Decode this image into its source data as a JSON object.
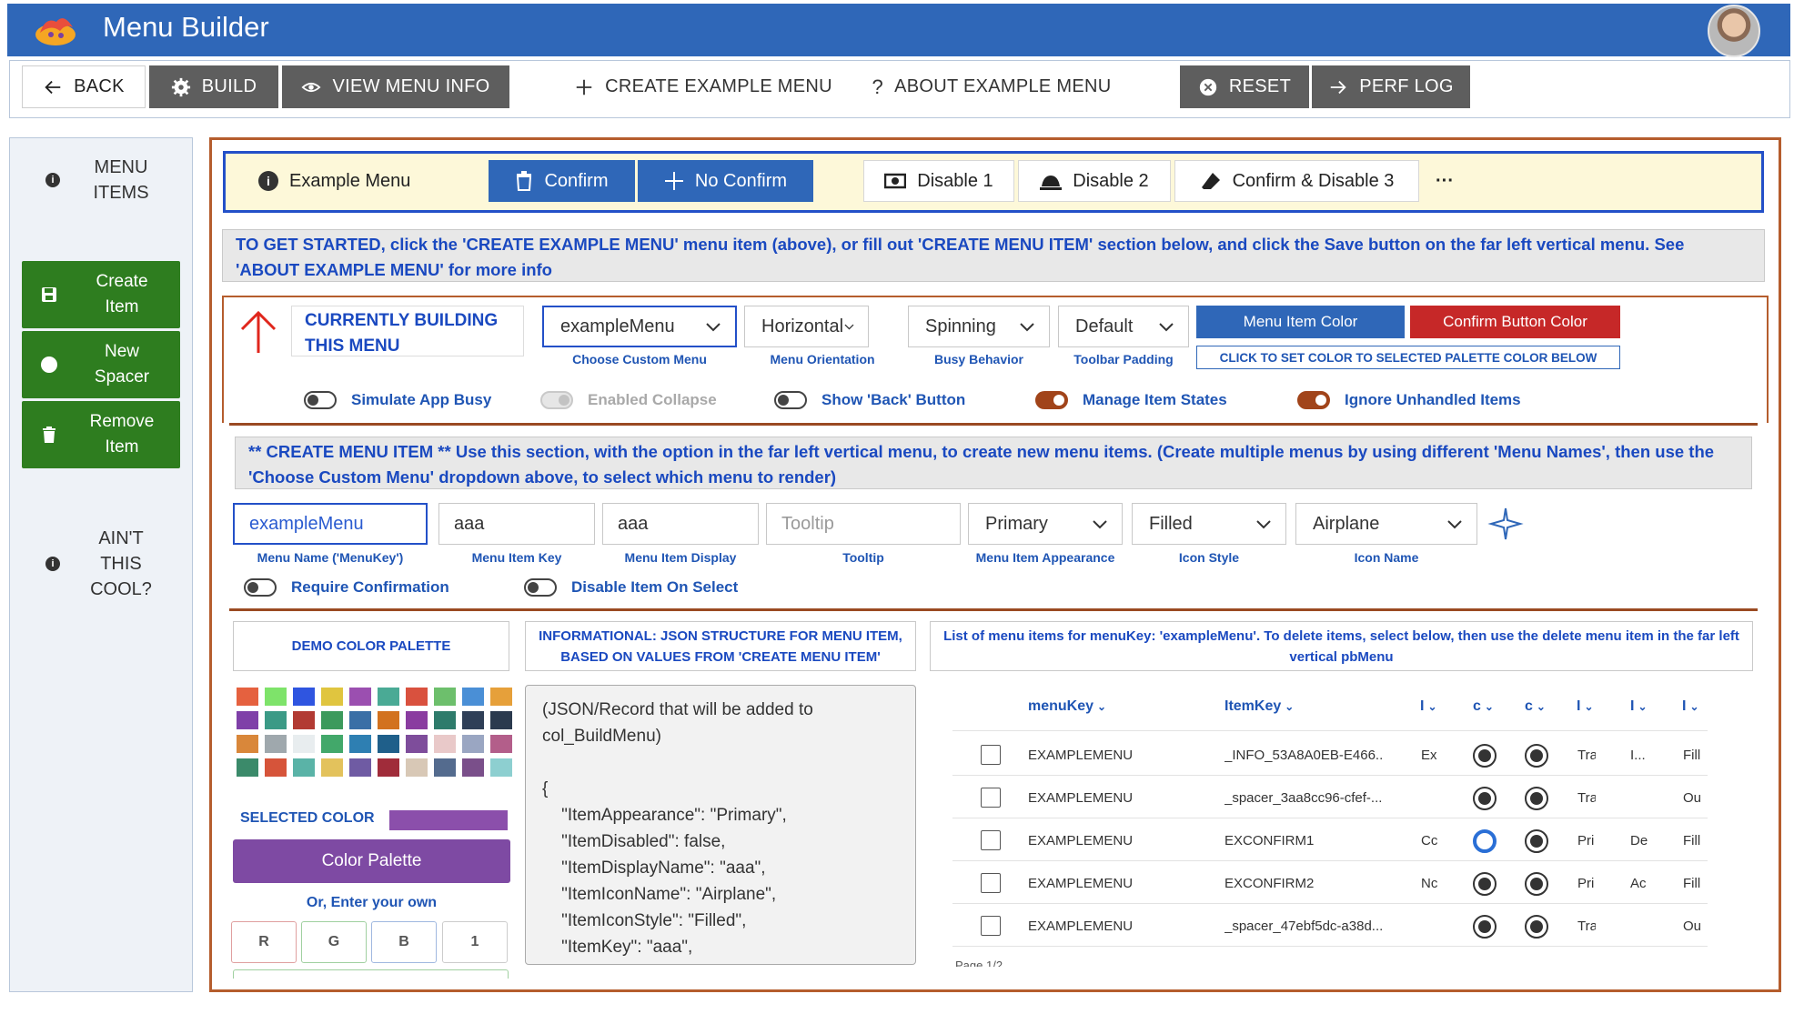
{
  "app": {
    "title": "Menu Builder",
    "logo_icon": "fire-dragon-logo-icon",
    "avatar_icon": "user-avatar"
  },
  "toolbar": {
    "back": "BACK",
    "build": "BUILD",
    "view_menu_info": "VIEW MENU INFO",
    "create_example_menu": "CREATE EXAMPLE MENU",
    "about_example_menu": "ABOUT EXAMPLE MENU",
    "reset": "RESET",
    "perf_log": "PERF LOG"
  },
  "sidebar": {
    "menu_items": "MENU\nITEMS",
    "create_item": "Create\nItem",
    "new_spacer": "New\nSpacer",
    "remove_item": "Remove\nItem",
    "aint_this_cool": "AIN'T\nTHIS\nCOOL?"
  },
  "menu_preview": {
    "example_menu": "Example Menu",
    "confirm": "Confirm",
    "no_confirm": "No Confirm",
    "disable1": "Disable 1",
    "disable2": "Disable 2",
    "confirm_disable3": "Confirm & Disable 3",
    "more": "···"
  },
  "banner_top": "TO GET STARTED, click the 'CREATE EXAMPLE MENU' menu item (above), or fill out 'CREATE MENU ITEM' section below, and click the Save button on the far left vertical menu. See 'ABOUT EXAMPLE MENU' for more info",
  "settings": {
    "currently_building": "CURRENTLY BUILDING THIS MENU",
    "custom_menu": {
      "value": "exampleMenu",
      "caption": "Choose Custom Menu"
    },
    "orientation": {
      "value": "Horizontal",
      "caption": "Menu Orientation"
    },
    "busy": {
      "value": "Spinning",
      "caption": "Busy Behavior"
    },
    "padding": {
      "value": "Default",
      "caption": "Toolbar Padding"
    },
    "menu_item_color": "Menu Item Color",
    "confirm_button_color": "Confirm Button Color",
    "set_color_caption": "CLICK TO SET COLOR TO SELECTED PALETTE COLOR BELOW",
    "toggles": {
      "simulate_busy": "Simulate App Busy",
      "enabled_collapse": "Enabled Collapse",
      "show_back": "Show 'Back' Button",
      "manage_states": "Manage Item States",
      "ignore_unhandled": "Ignore Unhandled Items"
    },
    "colors": {
      "blue": "#2f67b8",
      "red": "#c62828",
      "brown": "#a1441a"
    }
  },
  "banner_create": "** CREATE MENU ITEM ** Use this section, with the option in the far left vertical menu, to create new menu items. (Create multiple menus by using different 'Menu Names', then use the 'Choose Custom Menu' dropdown above, to select which menu to render)",
  "create_item": {
    "menu_name": {
      "value": "exampleMenu",
      "caption": "Menu Name ('MenuKey')"
    },
    "item_key": {
      "value": "aaa",
      "caption": "Menu Item Key"
    },
    "item_display": {
      "value": "aaa",
      "caption": "Menu Item Display"
    },
    "tooltip": {
      "placeholder": "Tooltip",
      "caption": "Tooltip"
    },
    "appearance": {
      "value": "Primary",
      "caption": "Menu Item Appearance"
    },
    "icon_style": {
      "value": "Filled",
      "caption": "Icon Style"
    },
    "icon_name": {
      "value": "Airplane",
      "caption": "Icon Name"
    },
    "require_confirmation": "Require Confirmation",
    "disable_on_select": "Disable Item On Select"
  },
  "palette": {
    "title": "DEMO COLOR PALETTE",
    "selected_label": "SELECTED COLOR",
    "selected_color": "#8b4fab",
    "button": "Color Palette",
    "enter_own": "Or, Enter your own",
    "r": "R",
    "g": "G",
    "b": "B",
    "a": "1",
    "swatches": [
      [
        "#e5613f",
        "#7ee36a",
        "#2f55e0",
        "#e0c53f",
        "#9b4fb0",
        "#4aaa95",
        "#d9513e",
        "#6dbf6c",
        "#4a8fd6",
        "#e6a03a"
      ],
      [
        "#7f40a8",
        "#3b9a86",
        "#b23a33",
        "#3c9a5c",
        "#3a6fa6",
        "#d2721f",
        "#8a3ca0",
        "#2e7b6b",
        "#2f3f57",
        "#2b3a4e"
      ],
      [
        "#d9873a",
        "#9fa8ad",
        "#e8edef",
        "#42a86a",
        "#2e7fb2",
        "#1f5f8a",
        "#7e4d9b",
        "#e9c9c9",
        "#9aa6c2",
        "#b35e8a"
      ],
      [
        "#3b8a6a",
        "#d6543a",
        "#5ab3a7",
        "#e3c25c",
        "#6f5ba3",
        "#a02c3a",
        "#d8c8b6",
        "#546b8e",
        "#7a4f8a",
        "#8dcfd0"
      ]
    ]
  },
  "json_info": {
    "title": "INFORMATIONAL: JSON STRUCTURE FOR MENU ITEM, BASED ON VALUES FROM 'CREATE MENU ITEM'",
    "body": "(JSON/Record that will be added to\ncol_BuildMenu)\n\n{\n    \"ItemAppearance\": \"Primary\",\n    \"ItemDisabled\": false,\n    \"ItemDisplayName\": \"aaa\",\n    \"ItemIconName\": \"Airplane\",\n    \"ItemIconStyle\": \"Filled\",\n    \"ItemKey\": \"aaa\","
  },
  "list": {
    "title": "List of menu items for menuKey: 'exampleMenu'. To delete items, select below, then use the delete menu item in the far left vertical pbMenu",
    "headers": [
      "menuKey",
      "ItemKey",
      "I",
      "c",
      "c",
      "I",
      "I",
      "I"
    ],
    "footer": "Page 1/2",
    "rows": [
      {
        "menuKey": "EXAMPLEMENU",
        "itemKey": "_INFO_53A8A0EB-E466...",
        "c3": "Ex",
        "r1": "filled",
        "r2": "filled",
        "c6": "Tra",
        "c7": "I...",
        "c8": "Fill"
      },
      {
        "menuKey": "EXAMPLEMENU",
        "itemKey": "_spacer_3aa8cc96-cfef-...",
        "c3": "",
        "r1": "filled",
        "r2": "filled",
        "c6": "Tra",
        "c7": "",
        "c8": "Ou"
      },
      {
        "menuKey": "EXAMPLEMENU",
        "itemKey": "EXCONFIRM1",
        "c3": "Cc",
        "r1": "hollow",
        "r2": "filled",
        "c6": "Pri",
        "c7": "De",
        "c8": "Fill"
      },
      {
        "menuKey": "EXAMPLEMENU",
        "itemKey": "EXCONFIRM2",
        "c3": "Nc",
        "r1": "filled",
        "r2": "filled",
        "c6": "Pri",
        "c7": "Ac",
        "c8": "Fill"
      },
      {
        "menuKey": "EXAMPLEMENU",
        "itemKey": "_spacer_47ebf5dc-a38d...",
        "c3": "",
        "r1": "filled",
        "r2": "filled",
        "c6": "Tra",
        "c7": "",
        "c8": "Ou"
      }
    ]
  }
}
